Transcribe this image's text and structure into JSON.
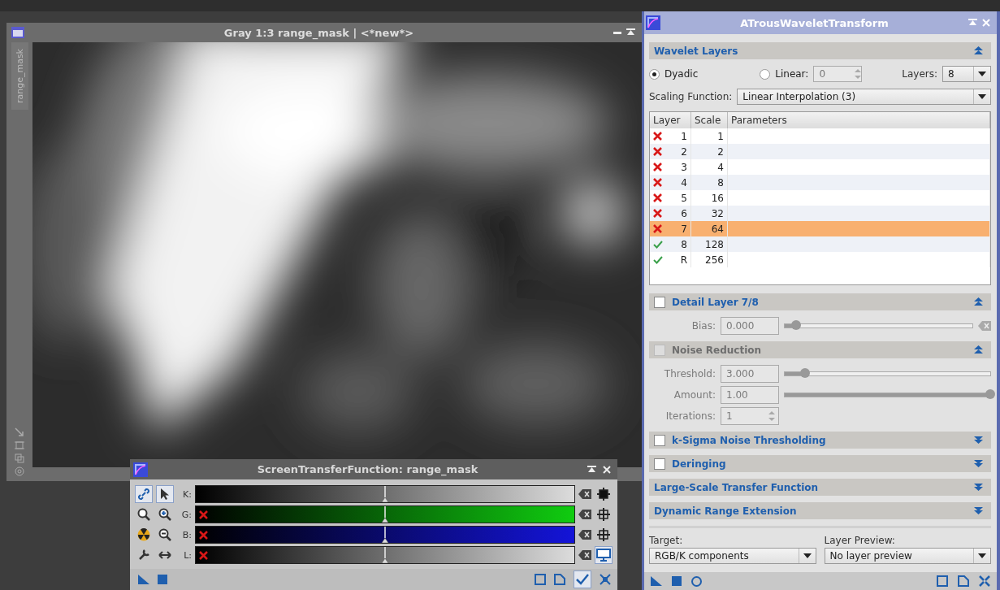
{
  "image_window": {
    "title": "Gray 1:3 range_mask | <*new*>",
    "tab": "range_mask"
  },
  "stf_window": {
    "title": "ScreenTransferFunction: range_mask",
    "link_selected": true,
    "apply_selected": true,
    "channels": [
      {
        "label": "K:",
        "color": "#dcdcdc",
        "inactive": false,
        "level": 0.5,
        "tool": {
          "kind": "crosshair",
          "selected": true
        }
      },
      {
        "label": "G:",
        "color": "#10cc10",
        "inactive": true,
        "level": 0.5,
        "tool": {
          "kind": "crosshair",
          "selected": false
        }
      },
      {
        "label": "B:",
        "color": "#1414d8",
        "inactive": true,
        "level": 0.5,
        "tool": {
          "kind": "crosshair",
          "selected": false
        }
      },
      {
        "label": "L:",
        "color": "#dcdcdc",
        "inactive": true,
        "level": 0.5,
        "tool": {
          "kind": "monitor",
          "selected": true
        }
      }
    ]
  },
  "atwt_window": {
    "title": "ATrousWaveletTransform",
    "wavelet_layers": {
      "title": "Wavelet Layers",
      "expanded": true,
      "modes": [
        {
          "label": "Dyadic",
          "selected": true
        },
        {
          "label": "Linear:",
          "selected": false
        }
      ],
      "linear_value": "0",
      "layers_label": "Layers:",
      "layers_value": "8",
      "scaling_label": "Scaling Function:",
      "scaling_value": "Linear Interpolation (3)",
      "table": {
        "columns": [
          "Layer",
          "Scale",
          "Parameters"
        ],
        "rows": [
          {
            "enabled": false,
            "layer": "1",
            "scale": "1",
            "selected": false
          },
          {
            "enabled": false,
            "layer": "2",
            "scale": "2",
            "selected": false
          },
          {
            "enabled": false,
            "layer": "3",
            "scale": "4",
            "selected": false
          },
          {
            "enabled": false,
            "layer": "4",
            "scale": "8",
            "selected": false
          },
          {
            "enabled": false,
            "layer": "5",
            "scale": "16",
            "selected": false
          },
          {
            "enabled": false,
            "layer": "6",
            "scale": "32",
            "selected": false
          },
          {
            "enabled": false,
            "layer": "7",
            "scale": "64",
            "selected": true
          },
          {
            "enabled": true,
            "layer": "8",
            "scale": "128",
            "selected": false
          },
          {
            "enabled": true,
            "layer": "R",
            "scale": "256",
            "selected": false
          }
        ]
      }
    },
    "sections": [
      {
        "title": "Detail Layer 7/8",
        "checkbox": {
          "checked": false
        },
        "disabled": false,
        "expanded": true,
        "params": [
          {
            "kind": "slider",
            "label": "Bias:",
            "value": "0.000",
            "level": 0.06,
            "disabled": true,
            "reset": true
          }
        ]
      },
      {
        "title": "Noise Reduction",
        "checkbox": {
          "checked": false
        },
        "disabled": true,
        "expanded": true,
        "params": [
          {
            "kind": "slider",
            "label": "Threshold:",
            "value": "3.000",
            "level": 0.1,
            "disabled": true,
            "reset": false
          },
          {
            "kind": "slider",
            "label": "Amount:",
            "value": "1.00",
            "level": 1.0,
            "disabled": true,
            "reset": false
          },
          {
            "kind": "spin",
            "label": "Iterations:",
            "value": "1",
            "disabled": true
          }
        ]
      },
      {
        "title": "k-Sigma Noise Thresholding",
        "checkbox": {
          "checked": false
        },
        "disabled": false,
        "expanded": false
      },
      {
        "title": "Deringing",
        "checkbox": {
          "checked": false
        },
        "disabled": false,
        "expanded": false
      },
      {
        "title": "Large-Scale Transfer Function",
        "disabled": false,
        "expanded": false
      },
      {
        "title": "Dynamic Range Extension",
        "disabled": false,
        "expanded": false
      }
    ],
    "target": {
      "label": "Target:",
      "value": "RGB/K components"
    },
    "layer_preview": {
      "label": "Layer Preview:",
      "value": "No layer preview"
    }
  }
}
